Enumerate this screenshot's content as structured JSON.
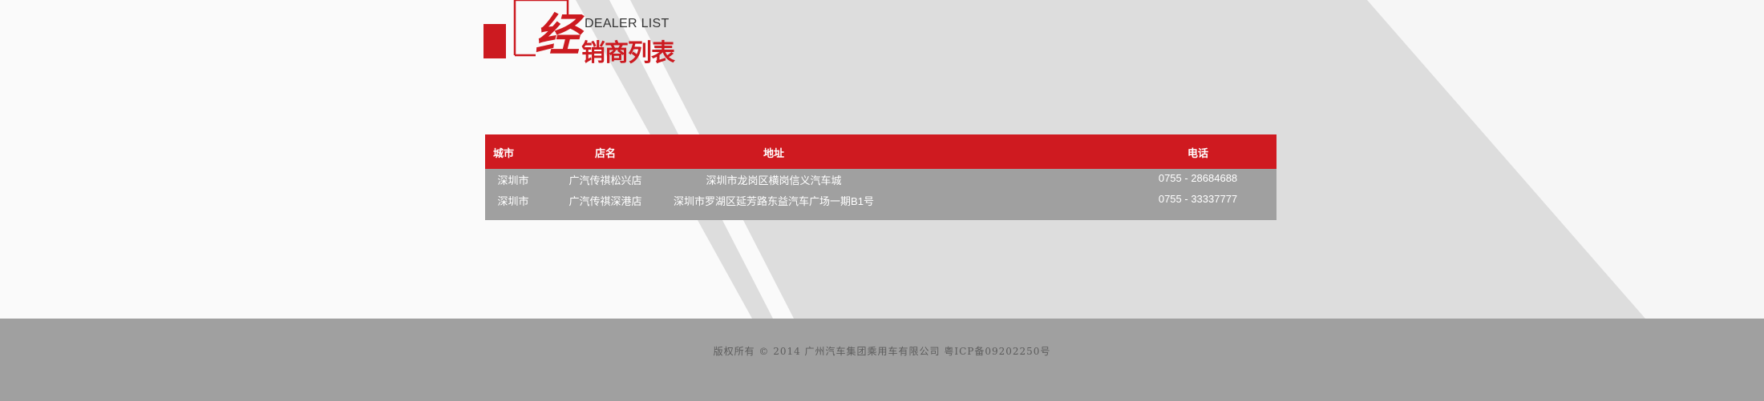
{
  "heading": {
    "big_char": "经",
    "en_title": "DEALER LIST",
    "cn_title": "销商列表"
  },
  "table": {
    "headers": [
      "城市",
      "店名",
      "地址",
      "电话"
    ],
    "rows": [
      [
        "深圳市",
        "广汽传祺松兴店",
        "深圳市龙岗区横岗信义汽车城",
        "0755 - 28684688"
      ],
      [
        "深圳市",
        "广汽传祺深港店",
        "深圳市罗湖区延芳路东益汽车广场一期B1号",
        "0755 - 33337777"
      ]
    ]
  },
  "footer": {
    "copyright": "版权所有 © 2014 广州汽车集团乘用车有限公司 粤ICP备09202250号"
  },
  "colors": {
    "accent": "#cc1a20",
    "footer_bg": "#a0a0a0",
    "table_body_bg": "#a0a0a0",
    "page_bg": "#fafafa",
    "stripe": "#dedede"
  }
}
